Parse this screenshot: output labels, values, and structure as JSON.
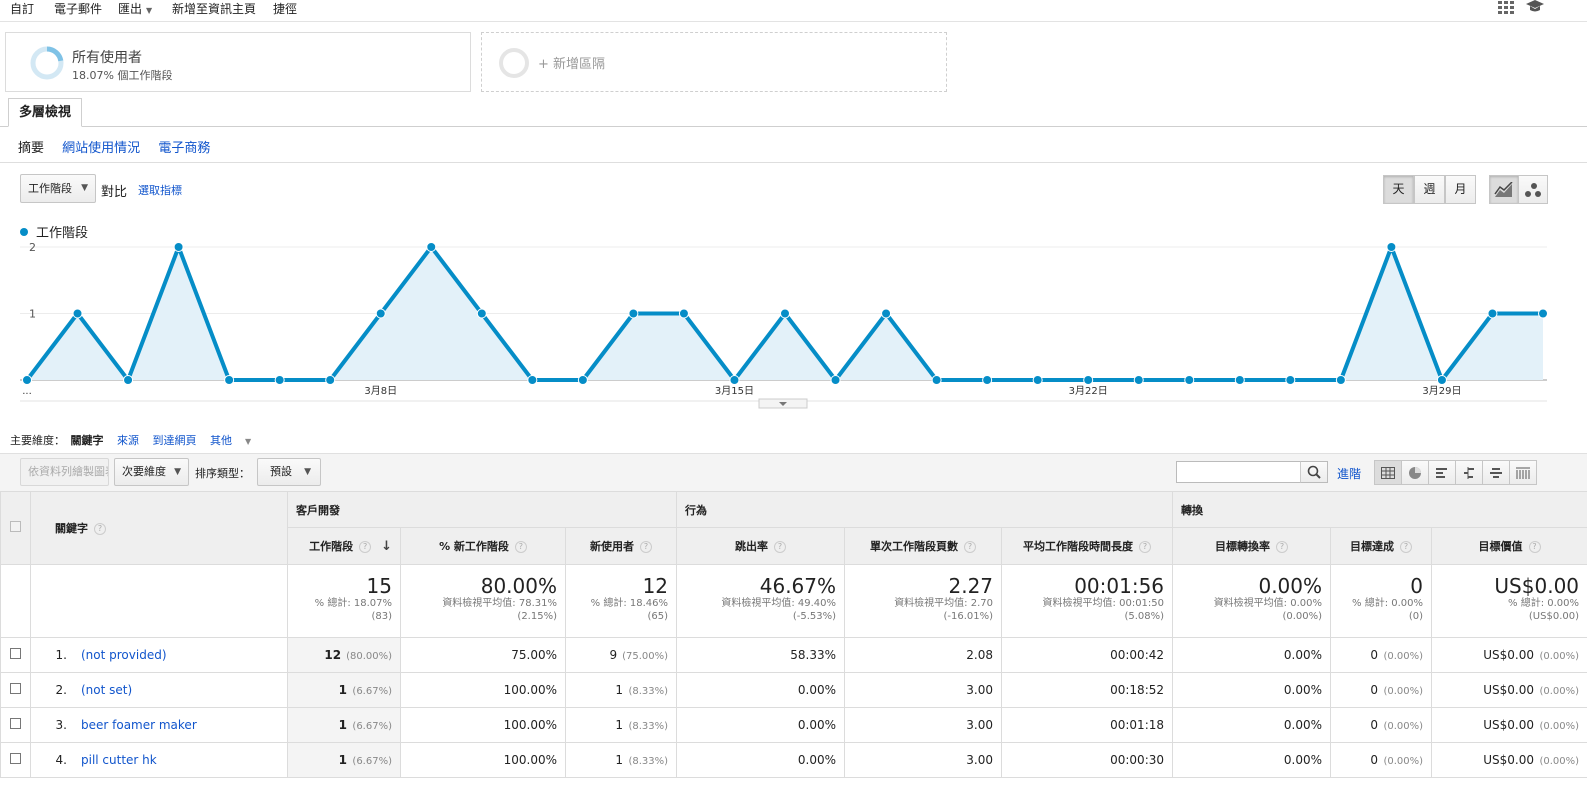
{
  "topbar": {
    "items": [
      "自訂",
      "電子郵件",
      "匯出",
      "新增至資訊主頁",
      "捷徑"
    ]
  },
  "segments": {
    "active": {
      "title": "所有使用者",
      "subtitle": "18.07% 個工作階段"
    },
    "add": {
      "label": "+ 新增區隔"
    }
  },
  "report": {
    "tab": "多層檢視",
    "subtabs": [
      "摘要",
      "網站使用情況",
      "電子商務"
    ]
  },
  "controls": {
    "metric_dropdown": "工作階段",
    "versus": "對比",
    "select_metric": "選取指標",
    "period": [
      "天",
      "週",
      "月"
    ],
    "active_period": "天"
  },
  "colors": {
    "accent": "#058dc7",
    "link": "#1155cc",
    "area_fill": "#e3f1f9"
  },
  "chart_data": {
    "type": "line",
    "series": [
      {
        "name": "工作階段",
        "values": [
          0,
          1,
          0,
          2,
          0,
          0,
          0,
          1,
          2,
          1,
          0,
          0,
          1,
          1,
          0,
          1,
          0,
          1,
          0,
          0,
          0,
          0,
          0,
          0,
          0,
          0,
          0,
          2,
          0,
          1,
          1
        ]
      }
    ],
    "x_tick_labels": [
      "...",
      "3月8日",
      "3月15日",
      "3月22日",
      "3月29日"
    ],
    "y_ticks": [
      1,
      2
    ],
    "ylim": [
      0,
      2
    ],
    "legend_position": "top-left",
    "grid": true
  },
  "dimensions": {
    "label": "主要維度：",
    "items": [
      "關鍵字",
      "來源",
      "到達網頁",
      "其他"
    ],
    "active": "關鍵字"
  },
  "toolbar": {
    "plot_rows": "依資料列繪製圖表",
    "secondary": "次要維度",
    "sort_label": "排序類型：",
    "sort_value": "預設",
    "advanced": "進階",
    "search_placeholder": ""
  },
  "table": {
    "groups": {
      "keyword": "關鍵字",
      "acquisition": "客戶開發",
      "behavior": "行為",
      "conversions": "轉換"
    },
    "columns": [
      "工作階段",
      "% 新工作階段",
      "新使用者",
      "跳出率",
      "單次工作階段頁數",
      "平均工作階段時間長度",
      "目標轉換率",
      "目標達成",
      "目標價值"
    ],
    "totals": [
      {
        "value": "15",
        "sub1": "% 總計: 18.07%",
        "sub2": "(83)"
      },
      {
        "value": "80.00%",
        "sub1": "資料檢視平均值: 78.31%",
        "sub2": "(2.15%)"
      },
      {
        "value": "12",
        "sub1": "% 總計: 18.46%",
        "sub2": "(65)"
      },
      {
        "value": "46.67%",
        "sub1": "資料檢視平均值: 49.40%",
        "sub2": "(-5.53%)"
      },
      {
        "value": "2.27",
        "sub1": "資料檢視平均值: 2.70",
        "sub2": "(-16.01%)"
      },
      {
        "value": "00:01:56",
        "sub1": "資料檢視平均值: 00:01:50",
        "sub2": "(5.08%)"
      },
      {
        "value": "0.00%",
        "sub1": "資料檢視平均值: 0.00%",
        "sub2": "(0.00%)"
      },
      {
        "value": "0",
        "sub1": "% 總計: 0.00%",
        "sub2": "(0)"
      },
      {
        "value": "US$0.00",
        "sub1": "% 總計: 0.00%",
        "sub2": "(US$0.00)"
      }
    ],
    "rows": [
      {
        "idx": "1.",
        "keyword": "(not provided)",
        "sessions": "12",
        "sessions_pct": "(80.00%)",
        "new_pct": "75.00%",
        "new_users": "9",
        "new_users_pct": "(75.00%)",
        "bounce": "58.33%",
        "pages": "2.08",
        "duration": "00:00:42",
        "conv_rate": "0.00%",
        "goal": "0",
        "goal_pct": "(0.00%)",
        "value": "US$0.00",
        "value_pct": "(0.00%)"
      },
      {
        "idx": "2.",
        "keyword": "(not set)",
        "sessions": "1",
        "sessions_pct": "(6.67%)",
        "new_pct": "100.00%",
        "new_users": "1",
        "new_users_pct": "(8.33%)",
        "bounce": "0.00%",
        "pages": "3.00",
        "duration": "00:18:52",
        "conv_rate": "0.00%",
        "goal": "0",
        "goal_pct": "(0.00%)",
        "value": "US$0.00",
        "value_pct": "(0.00%)"
      },
      {
        "idx": "3.",
        "keyword": "beer foamer maker",
        "sessions": "1",
        "sessions_pct": "(6.67%)",
        "new_pct": "100.00%",
        "new_users": "1",
        "new_users_pct": "(8.33%)",
        "bounce": "0.00%",
        "pages": "3.00",
        "duration": "00:01:18",
        "conv_rate": "0.00%",
        "goal": "0",
        "goal_pct": "(0.00%)",
        "value": "US$0.00",
        "value_pct": "(0.00%)"
      },
      {
        "idx": "4.",
        "keyword": "pill cutter hk",
        "sessions": "1",
        "sessions_pct": "(6.67%)",
        "new_pct": "100.00%",
        "new_users": "1",
        "new_users_pct": "(8.33%)",
        "bounce": "0.00%",
        "pages": "3.00",
        "duration": "00:00:30",
        "conv_rate": "0.00%",
        "goal": "0",
        "goal_pct": "(0.00%)",
        "value": "US$0.00",
        "value_pct": "(0.00%)"
      }
    ]
  }
}
